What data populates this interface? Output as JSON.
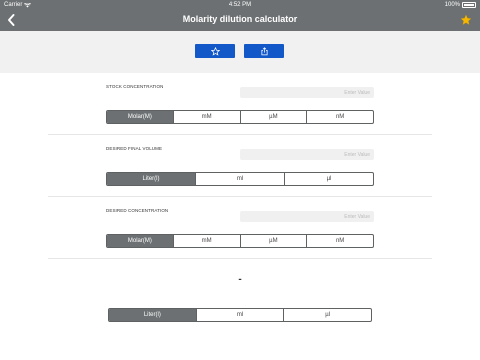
{
  "status_bar": {
    "carrier": "Carrier",
    "time": "4:52 PM",
    "battery": "100%"
  },
  "header": {
    "title": "Molarity dilution calculator",
    "back_icon": "chevron-left-icon",
    "favorite_icon": "star-icon"
  },
  "toolbar": {
    "favorite_icon": "star-outline-icon",
    "share_icon": "share-icon"
  },
  "colors": {
    "header": "#6c7072",
    "accent": "#1358c9",
    "favorite": "#f5b800"
  },
  "stock": {
    "label": "STOCK CONCENTRATION",
    "input_value": "",
    "placeholder": "Enter Value",
    "units": [
      "Molar(M)",
      "mM",
      "µM",
      "nM"
    ],
    "selected_unit": "Molar(M)"
  },
  "final_volume": {
    "label": "DESIRED FINAL VOLUME",
    "input_value": "",
    "placeholder": "Enter Value",
    "units": [
      "Liter(l)",
      "ml",
      "µl"
    ],
    "selected_unit": "Liter(l)"
  },
  "desired_conc": {
    "label": "DESIRED CONCENTRATION",
    "input_value": "",
    "placeholder": "Enter Value",
    "units": [
      "Molar(M)",
      "mM",
      "µM",
      "nM"
    ],
    "selected_unit": "Molar(M)"
  },
  "result": {
    "value": "-",
    "units": [
      "Liter(l)",
      "ml",
      "µl"
    ],
    "selected_unit": "Liter(l)"
  }
}
